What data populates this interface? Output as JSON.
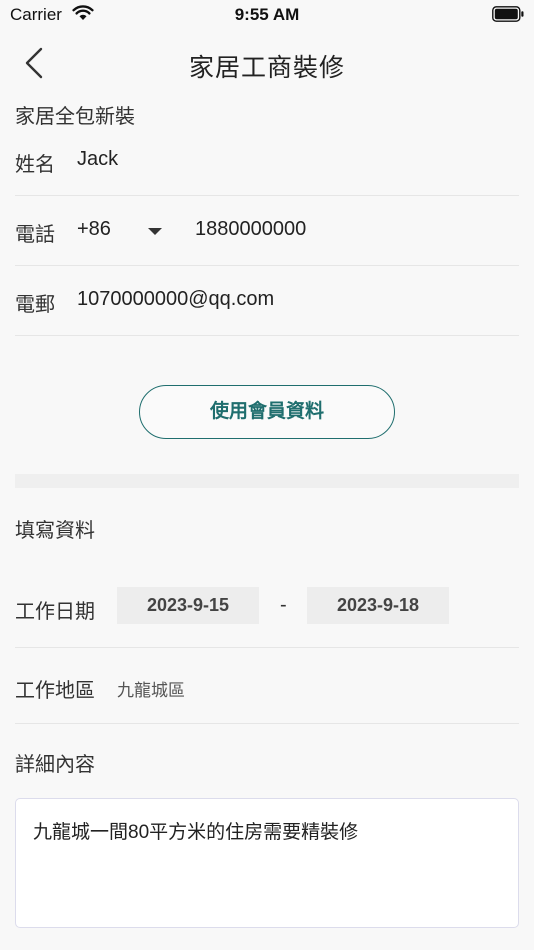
{
  "status_bar": {
    "carrier": "Carrier",
    "time": "9:55 AM",
    "wifi_icon": "wifi-icon",
    "battery_icon": "battery-icon"
  },
  "nav": {
    "back_icon": "chevron-left-icon",
    "title": "家居工商裝修"
  },
  "service_type": "家居全包新裝",
  "contact": {
    "name_label": "姓名",
    "name_value": "Jack",
    "phone_label": "電話",
    "country_code": "+86",
    "phone_value": "1880000000",
    "email_label": "電郵",
    "email_value": "1070000000@qq.com"
  },
  "member_button_label": "使用會員資料",
  "form": {
    "section_title": "填寫資料",
    "work_date_label": "工作日期",
    "start_date": "2023-9-15",
    "date_separator": "-",
    "end_date": "2023-9-18",
    "work_area_label": "工作地區",
    "work_area_value": "九龍城區",
    "detail_label": "詳細內容",
    "detail_value": "九龍城一間80平方米的住房需要精裝修"
  },
  "colors": {
    "accent": "#1f6e6e",
    "background": "#f8f8f8",
    "date_box": "#ededed"
  }
}
